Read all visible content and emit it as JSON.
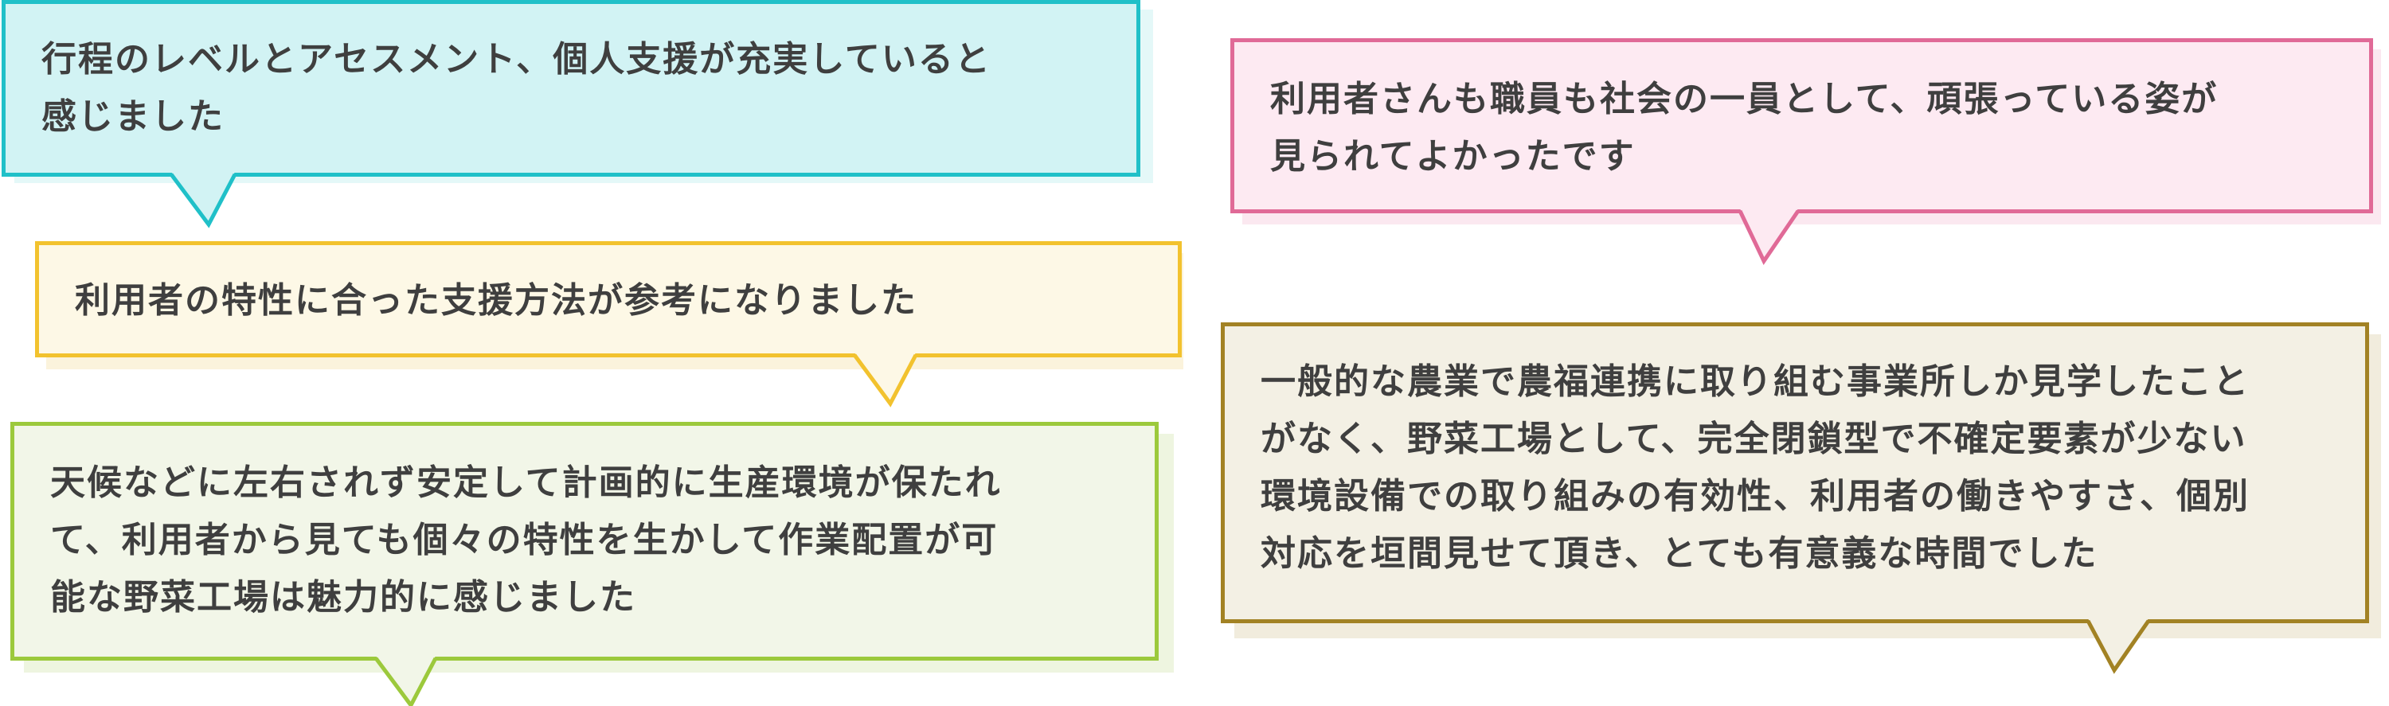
{
  "comments": [
    {
      "text": "行程のレベルとアセスメント、個人支援が充実していると\n感じました",
      "border_color": "#20c0c8",
      "fill_color": "#d2f3f4",
      "shadow_color": "#e4f8f8"
    },
    {
      "text": "利用者の特性に合った支援方法が参考になりました",
      "border_color": "#f2c22e",
      "fill_color": "#fdf8e6",
      "shadow_color": "#fbf3dc"
    },
    {
      "text": "天候などに左右されず安定して計画的に生産環境が保たれ\nて、利用者から見ても個々の特性を生かして作業配置が可\n能な野菜工場は魅力的に感じました",
      "border_color": "#9cc93c",
      "fill_color": "#f2f6e8",
      "shadow_color": "#eef5e0"
    },
    {
      "text": "利用者さんも職員も社会の一員として、頑張っている姿が\n見られてよかったです",
      "border_color": "#e06a97",
      "fill_color": "#fdeaf2",
      "shadow_color": "#fbe8f0"
    },
    {
      "text": "一般的な農業で農福連携に取り組む事業所しか見学したこと\nがなく、野菜工場として、完全閉鎖型で不確定要素が少ない\n環境設備での取り組みの有効性、利用者の働きやすさ、個別\n対応を垣間見せて頂き、とても有意義な時間でした",
      "border_color": "#a28224",
      "fill_color": "#f3f0e4",
      "shadow_color": "#f1ecdd"
    }
  ]
}
